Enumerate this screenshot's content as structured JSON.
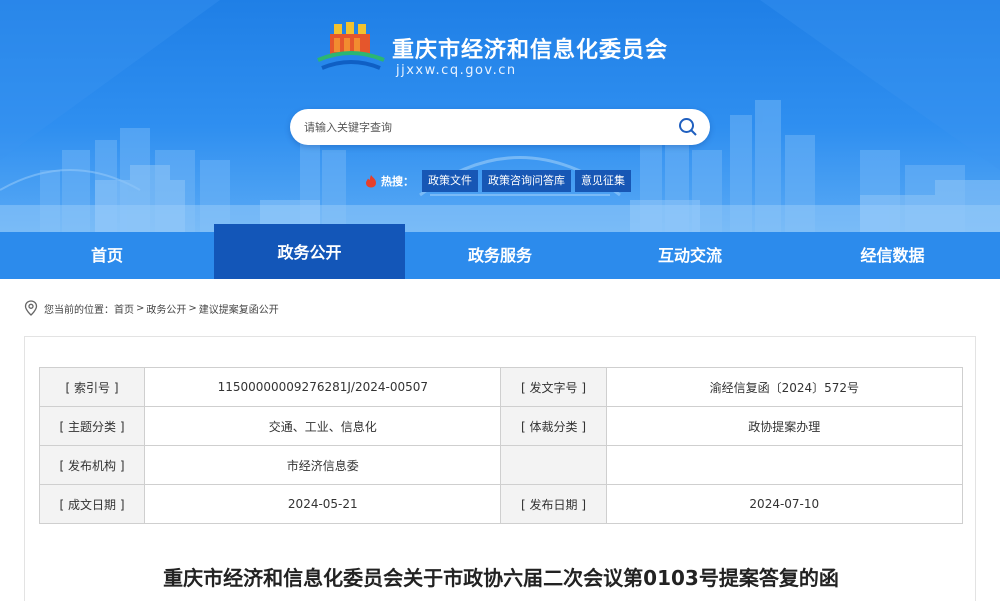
{
  "header": {
    "site_title": "重庆市经济和信息化委员会",
    "site_domain": "jjxxw.cq.gov.cn",
    "logo_icon": "government-building-logo-icon"
  },
  "search": {
    "placeholder": "请输入关键字查询",
    "icon": "search-icon"
  },
  "hot_search": {
    "label": "热搜：",
    "icon": "fire-icon",
    "tags": [
      "政策文件",
      "政策咨询问答库",
      "意见征集"
    ]
  },
  "nav": {
    "items": [
      "首页",
      "政务公开",
      "政务服务",
      "互动交流",
      "经信数据"
    ],
    "active": "政务公开"
  },
  "breadcrumb": {
    "prefix": "您当前的位置：",
    "items": [
      "首页",
      "政务公开",
      "建议提案复函公开"
    ],
    "separator": ">"
  },
  "meta": {
    "index_label": "[ 索引号 ]",
    "index_value": "11500000009276281J/2024-00507",
    "doc_no_label": "[ 发文字号 ]",
    "doc_no_value": "渝经信复函〔2024〕572号",
    "topic_label": "[ 主题分类 ]",
    "topic_value": "交通、工业、信息化",
    "genre_label": "[ 体裁分类 ]",
    "genre_value": "政协提案办理",
    "issuer_label": "[ 发布机构 ]",
    "issuer_value": "市经济信息委",
    "issuer_extra_label": "",
    "issuer_extra_value": "",
    "written_label": "[ 成文日期 ]",
    "written_value": "2024-05-21",
    "publish_label": "[ 发布日期 ]",
    "publish_value": "2024-07-10"
  },
  "document": {
    "title": "重庆市经济和信息化委员会关于市政协六届二次会议第0103号提案答复的函"
  },
  "colors": {
    "banner_blue": "#2f8ff0",
    "nav_blue": "#2c8bec",
    "nav_active": "#1356b8",
    "tag_bg": "#1757b5"
  }
}
